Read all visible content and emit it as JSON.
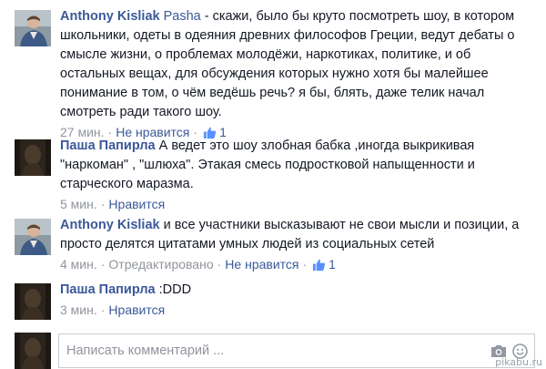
{
  "comments": [
    {
      "author": "Anthony Kisliak",
      "mention": "Pasha",
      "text": " - скажи, было бы круто посмотреть шоу, в котором школьники, одеты в одеяния древних философов Греции, ведут дебаты о смысле жизни, о проблемах молодёжи, наркотиках, политике, и об остальных вещах, для обсуждения которых нужно хотя бы малейшее понимание в том, о чём ведёшь речь? я бы, блять, даже телик начал смотреть ради такого шоу.",
      "time": "27 мин.",
      "like_action": "Не нравится",
      "likes": "1"
    },
    {
      "author": "Паша Папирла",
      "text": " А ведет это шоу злобная бабка ,иногда выкрикивая \"наркоман\" , \"шлюха\". Этакая смесь подростковой напыщенности и старческого маразма.",
      "time": "5 мин.",
      "like_action": "Нравится"
    },
    {
      "author": "Anthony Kisliak",
      "text": " и все участники высказывают не свои мысли и позиции, а просто делятся цитатами умных людей из социальных сетей",
      "time": "4 мин.",
      "edited": "Отредактировано",
      "like_action": "Не нравится",
      "likes": "1"
    },
    {
      "author": "Паша Папирла",
      "text": " :DDD",
      "time": "3 мин.",
      "like_action": "Нравится"
    }
  ],
  "composer": {
    "placeholder": "Написать комментарий ..."
  },
  "watermark": "pikabu.ru",
  "colors": {
    "link": "#3b5998",
    "meta": "#90949c",
    "text": "#141823"
  }
}
